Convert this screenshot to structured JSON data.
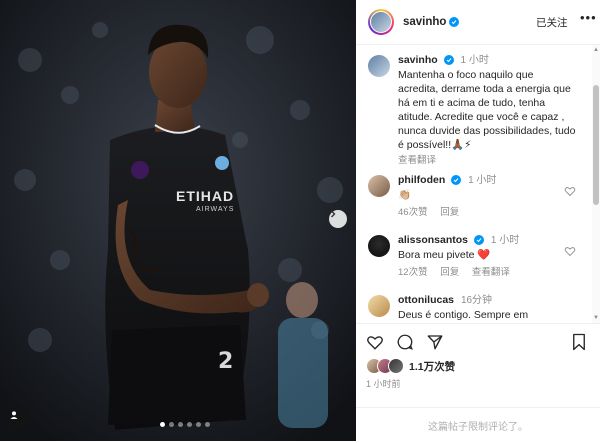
{
  "post": {
    "username": "savinho",
    "follow_status": "已关注",
    "caption": "Mantenha o foco naquilo que acredita, derrame toda a energia que há em ti e acima de tudo, tenha atitude. Acredite que você e capaz , nunca duvide das possibilidades, tudo é possível!!🙏🏾⚡",
    "caption_time": "1 小时",
    "translate_label": "查看翻译",
    "jersey_sponsor": "ETIHAD",
    "jersey_sponsor_sub": "AIRWAYS",
    "likes_label": "1.1万次赞",
    "posted_label": "1 小时前",
    "comments_restricted": "这篇帖子限制评论了。",
    "media_slide_count": 6,
    "media_active_slide": 0
  },
  "comments": [
    {
      "user": "philfoden",
      "verified": true,
      "time": "1 小时",
      "text": "👏🏼",
      "likes": "46次赞",
      "reply": "回复",
      "translate": ""
    },
    {
      "user": "alissonsantos",
      "verified": true,
      "time": "1 小时",
      "text": "Bora meu pivete ❤️",
      "likes": "12次赞",
      "reply": "回复",
      "translate": "查看翻译"
    },
    {
      "user": "ottonilucas",
      "verified": false,
      "time": "16分钟",
      "text": "Deus é contigo. Sempre em",
      "likes": "",
      "reply": "",
      "translate": ""
    }
  ],
  "icons": {
    "like": "heart-icon",
    "comment": "comment-icon",
    "share": "share-icon",
    "save": "bookmark-icon",
    "more": "more-options-icon",
    "verified": "verified-badge-icon",
    "next": "chevron-right-icon",
    "tagged": "user-tag-icon"
  },
  "colors": {
    "verified": "#0095f6",
    "heart_red": "#ed4956",
    "muted_text": "#8e8e8e"
  }
}
